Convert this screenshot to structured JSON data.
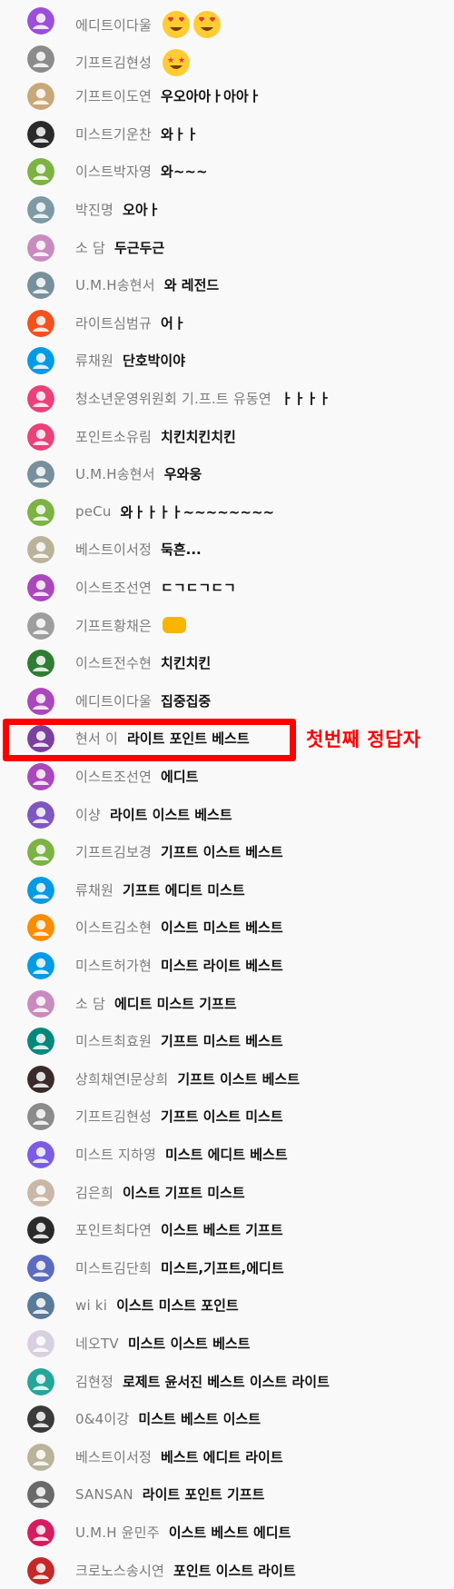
{
  "colors": {
    "highlight": "#ff0000",
    "name_text": "#7b7b7b",
    "message_text": "#111111"
  },
  "annotation": {
    "label": "첫번째 정답자"
  },
  "messages": [
    {
      "author": "에디트이다울",
      "text": "",
      "avatar": "#9c4fd9",
      "emoji": "heart-eyes-emoji x2"
    },
    {
      "author": "기프트김현성",
      "text": "",
      "avatar": "#8b8b8b",
      "emoji": "star-struck-emoji"
    },
    {
      "author": "기프트이도연",
      "text": "우오아아ㅏ아아ㅏ",
      "avatar": "#c8a878"
    },
    {
      "author": "미스트기운찬",
      "text": "와ㅏㅏ",
      "avatar": "#2a2a2a"
    },
    {
      "author": "이스트박자영",
      "text": "와~~~",
      "avatar": "#7cb342"
    },
    {
      "author": "박진명",
      "text": "오아ㅏ",
      "avatar": "#7d9aa5"
    },
    {
      "author": "소 담",
      "text": "두근두근",
      "avatar": "#c98bbf"
    },
    {
      "author": "U.M.H송현서",
      "text": "와 레전드",
      "avatar": "#78909c"
    },
    {
      "author": "라이트심범규",
      "text": "어ㅏ",
      "avatar": "#f4511e"
    },
    {
      "author": "류채원",
      "text": "단호박이야",
      "avatar": "#039be5"
    },
    {
      "author": "청소년운영위원회 기.프.트 유동연",
      "text": "ㅏㅏㅏㅏ",
      "avatar": "#ec407a"
    },
    {
      "author": "포인트소유림",
      "text": "치킨치킨치킨",
      "avatar": "#ec407a"
    },
    {
      "author": "U.M.H송현서",
      "text": "우와웅",
      "avatar": "#78909c"
    },
    {
      "author": "peCu",
      "text": "와ㅏㅏㅏㅏ~~~~~~~~",
      "avatar": "#7cb342"
    },
    {
      "author": "베스트이서정",
      "text": "둑흔...",
      "avatar": "#b9b39a"
    },
    {
      "author": "이스트조선연",
      "text": "ㄷㄱㄷㄱㄷㄱ",
      "avatar": "#ab47bc"
    },
    {
      "author": "기프트황채은",
      "text": "",
      "avatar": "#9e9e9e",
      "emoji": "hands-emoji"
    },
    {
      "author": "이스트전수현",
      "text": "치킨치킨",
      "avatar": "#2e7d32"
    },
    {
      "author": "에디트이다울",
      "text": "집중집중",
      "avatar": "#ab47bc"
    },
    {
      "author": "현서 이",
      "text": "라이트 포인트 베스트",
      "avatar": "#7b3fa0"
    },
    {
      "author": "이스트조선연",
      "text": "에디트",
      "avatar": "#ab47bc"
    },
    {
      "author": "이샹",
      "text": "라이트 이스트 베스트",
      "avatar": "#7e57c2"
    },
    {
      "author": "기프트김보경",
      "text": "기프트 이스트 베스트",
      "avatar": "#7cb342"
    },
    {
      "author": "류채원",
      "text": "기프트 에디트 미스트",
      "avatar": "#039be5"
    },
    {
      "author": "이스트김소현",
      "text": "이스트 미스트 베스트",
      "avatar": "#fb8c00"
    },
    {
      "author": "미스트허가현",
      "text": "미스트 라이트 베스트",
      "avatar": "#039be5"
    },
    {
      "author": "소 담",
      "text": "에디트 미스트 기프트",
      "avatar": "#c98bbf"
    },
    {
      "author": "미스트최효원",
      "text": "기프트 미스트 베스트",
      "avatar": "#00897b"
    },
    {
      "author": "상희채연l문상희",
      "text": "기프트 이스트 베스트",
      "avatar": "#3a2a2a"
    },
    {
      "author": "기프트김현성",
      "text": "기프트 이스트 미스트",
      "avatar": "#8b8b8b"
    },
    {
      "author": "미스트 지하영",
      "text": "미스트 에디트 베스트",
      "avatar": "#7c5ce6"
    },
    {
      "author": "김은희",
      "text": "이스트 기프트 미스트",
      "avatar": "#c9b8a8"
    },
    {
      "author": "포인트최다연",
      "text": "이스트 베스트 기프트",
      "avatar": "#2a2a2a"
    },
    {
      "author": "미스트김단희",
      "text": "미스트,기프트,에디트",
      "avatar": "#5c6bc0"
    },
    {
      "author": "wi ki",
      "text": "이스트 미스트 포인트",
      "avatar": "#5a7a9a"
    },
    {
      "author": "네오TV",
      "text": "미스트 이스트 베스트",
      "avatar": "#d8d0e0"
    },
    {
      "author": "김현정",
      "text": "로제트 윤서진 베스트 이스트 라이트",
      "avatar": "#26a69a"
    },
    {
      "author": "0&4이강",
      "text": "미스트 베스트 이스트",
      "avatar": "#3a3a3a"
    },
    {
      "author": "베스트이서정",
      "text": "베스트 에디트 라이트",
      "avatar": "#b9b39a"
    },
    {
      "author": "SANSAN",
      "text": "라이트 포인트 기프트",
      "avatar": "#6a6a6a"
    },
    {
      "author": "U.M.H 윤민주",
      "text": "이스트 베스트 에디트",
      "avatar": "#d81b60"
    },
    {
      "author": "크로노스송시연",
      "text": "포인트 이스트 라이트",
      "avatar": "#c62828"
    }
  ]
}
